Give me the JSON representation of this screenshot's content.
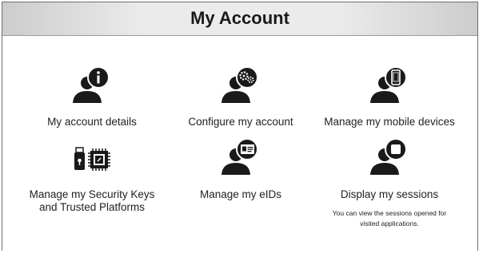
{
  "header": {
    "title": "My Account"
  },
  "tiles": [
    {
      "label": "My account details",
      "icon": "user-info-icon"
    },
    {
      "label": "Configure my account",
      "icon": "user-gears-icon"
    },
    {
      "label": "Manage my mobile devices",
      "icon": "user-mobile-icon"
    },
    {
      "label_line1": "Manage my Security Keys",
      "label_line2": "and Trusted Platforms",
      "icon": "security-key-chip-icon"
    },
    {
      "label": "Manage my eIDs",
      "icon": "user-id-card-icon"
    },
    {
      "label": "Display my sessions",
      "icon": "user-session-icon",
      "desc_line1": "You can view the sessions opened for",
      "desc_line2": "visited applications."
    }
  ],
  "colors": {
    "icon": "#1a1a1a",
    "header_bg": "#ebebeb"
  }
}
